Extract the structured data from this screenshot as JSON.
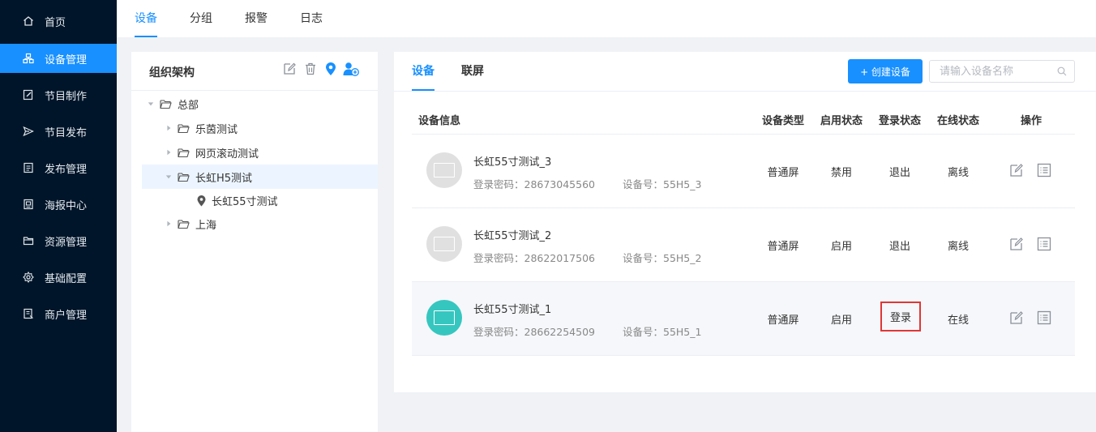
{
  "sidebar": {
    "items": [
      {
        "label": "首页",
        "icon": "home-icon"
      },
      {
        "label": "设备管理",
        "icon": "devices-icon"
      },
      {
        "label": "节目制作",
        "icon": "edit-icon"
      },
      {
        "label": "节目发布",
        "icon": "send-icon"
      },
      {
        "label": "发布管理",
        "icon": "list-icon"
      },
      {
        "label": "海报中心",
        "icon": "poster-icon"
      },
      {
        "label": "资源管理",
        "icon": "folder-icon"
      },
      {
        "label": "基础配置",
        "icon": "gear-icon"
      },
      {
        "label": "商户管理",
        "icon": "merchant-icon"
      }
    ],
    "active_index": 1,
    "bg_color": "#001529",
    "active_color": "#1890ff"
  },
  "top_tabs": [
    "设备",
    "分组",
    "报警",
    "日志"
  ],
  "org": {
    "title": "组织架构",
    "tools": [
      "edit-icon",
      "delete-icon",
      "location-icon",
      "add-user-icon"
    ],
    "tree": [
      {
        "label": "总部",
        "level": 0,
        "expanded": true
      },
      {
        "label": "乐茵测试",
        "level": 1
      },
      {
        "label": "网页滚动测试",
        "level": 1
      },
      {
        "label": "长虹H5测试",
        "level": 1,
        "expanded": true,
        "selected": true
      },
      {
        "label": "长虹55寸测试",
        "level": 2,
        "leaf": true
      },
      {
        "label": "上海",
        "level": 1
      }
    ]
  },
  "panel": {
    "tabs": [
      "设备",
      "联屏"
    ],
    "create_label": "+ 创建设备",
    "search_placeholder": "请输入设备名称",
    "columns": {
      "info": "设备信息",
      "type": "设备类型",
      "enable": "启用状态",
      "login": "登录状态",
      "online": "在线状态",
      "actions": "操作"
    },
    "rows": [
      {
        "name": "长虹55寸测试_3",
        "password": "登录密码：28673045560",
        "device_no": "设备号：55H5_3",
        "type": "普通屏",
        "enable": "禁用",
        "login": "退出",
        "online": "离线",
        "is_online": false
      },
      {
        "name": "长虹55寸测试_2",
        "password": "登录密码：28622017506",
        "device_no": "设备号：55H5_2",
        "type": "普通屏",
        "enable": "启用",
        "login": "退出",
        "online": "离线",
        "is_online": false
      },
      {
        "name": "长虹55寸测试_1",
        "password": "登录密码：28662254509",
        "device_no": "设备号：55H5_1",
        "type": "普通屏",
        "enable": "启用",
        "login": "登录",
        "online": "在线",
        "is_online": true
      }
    ]
  }
}
